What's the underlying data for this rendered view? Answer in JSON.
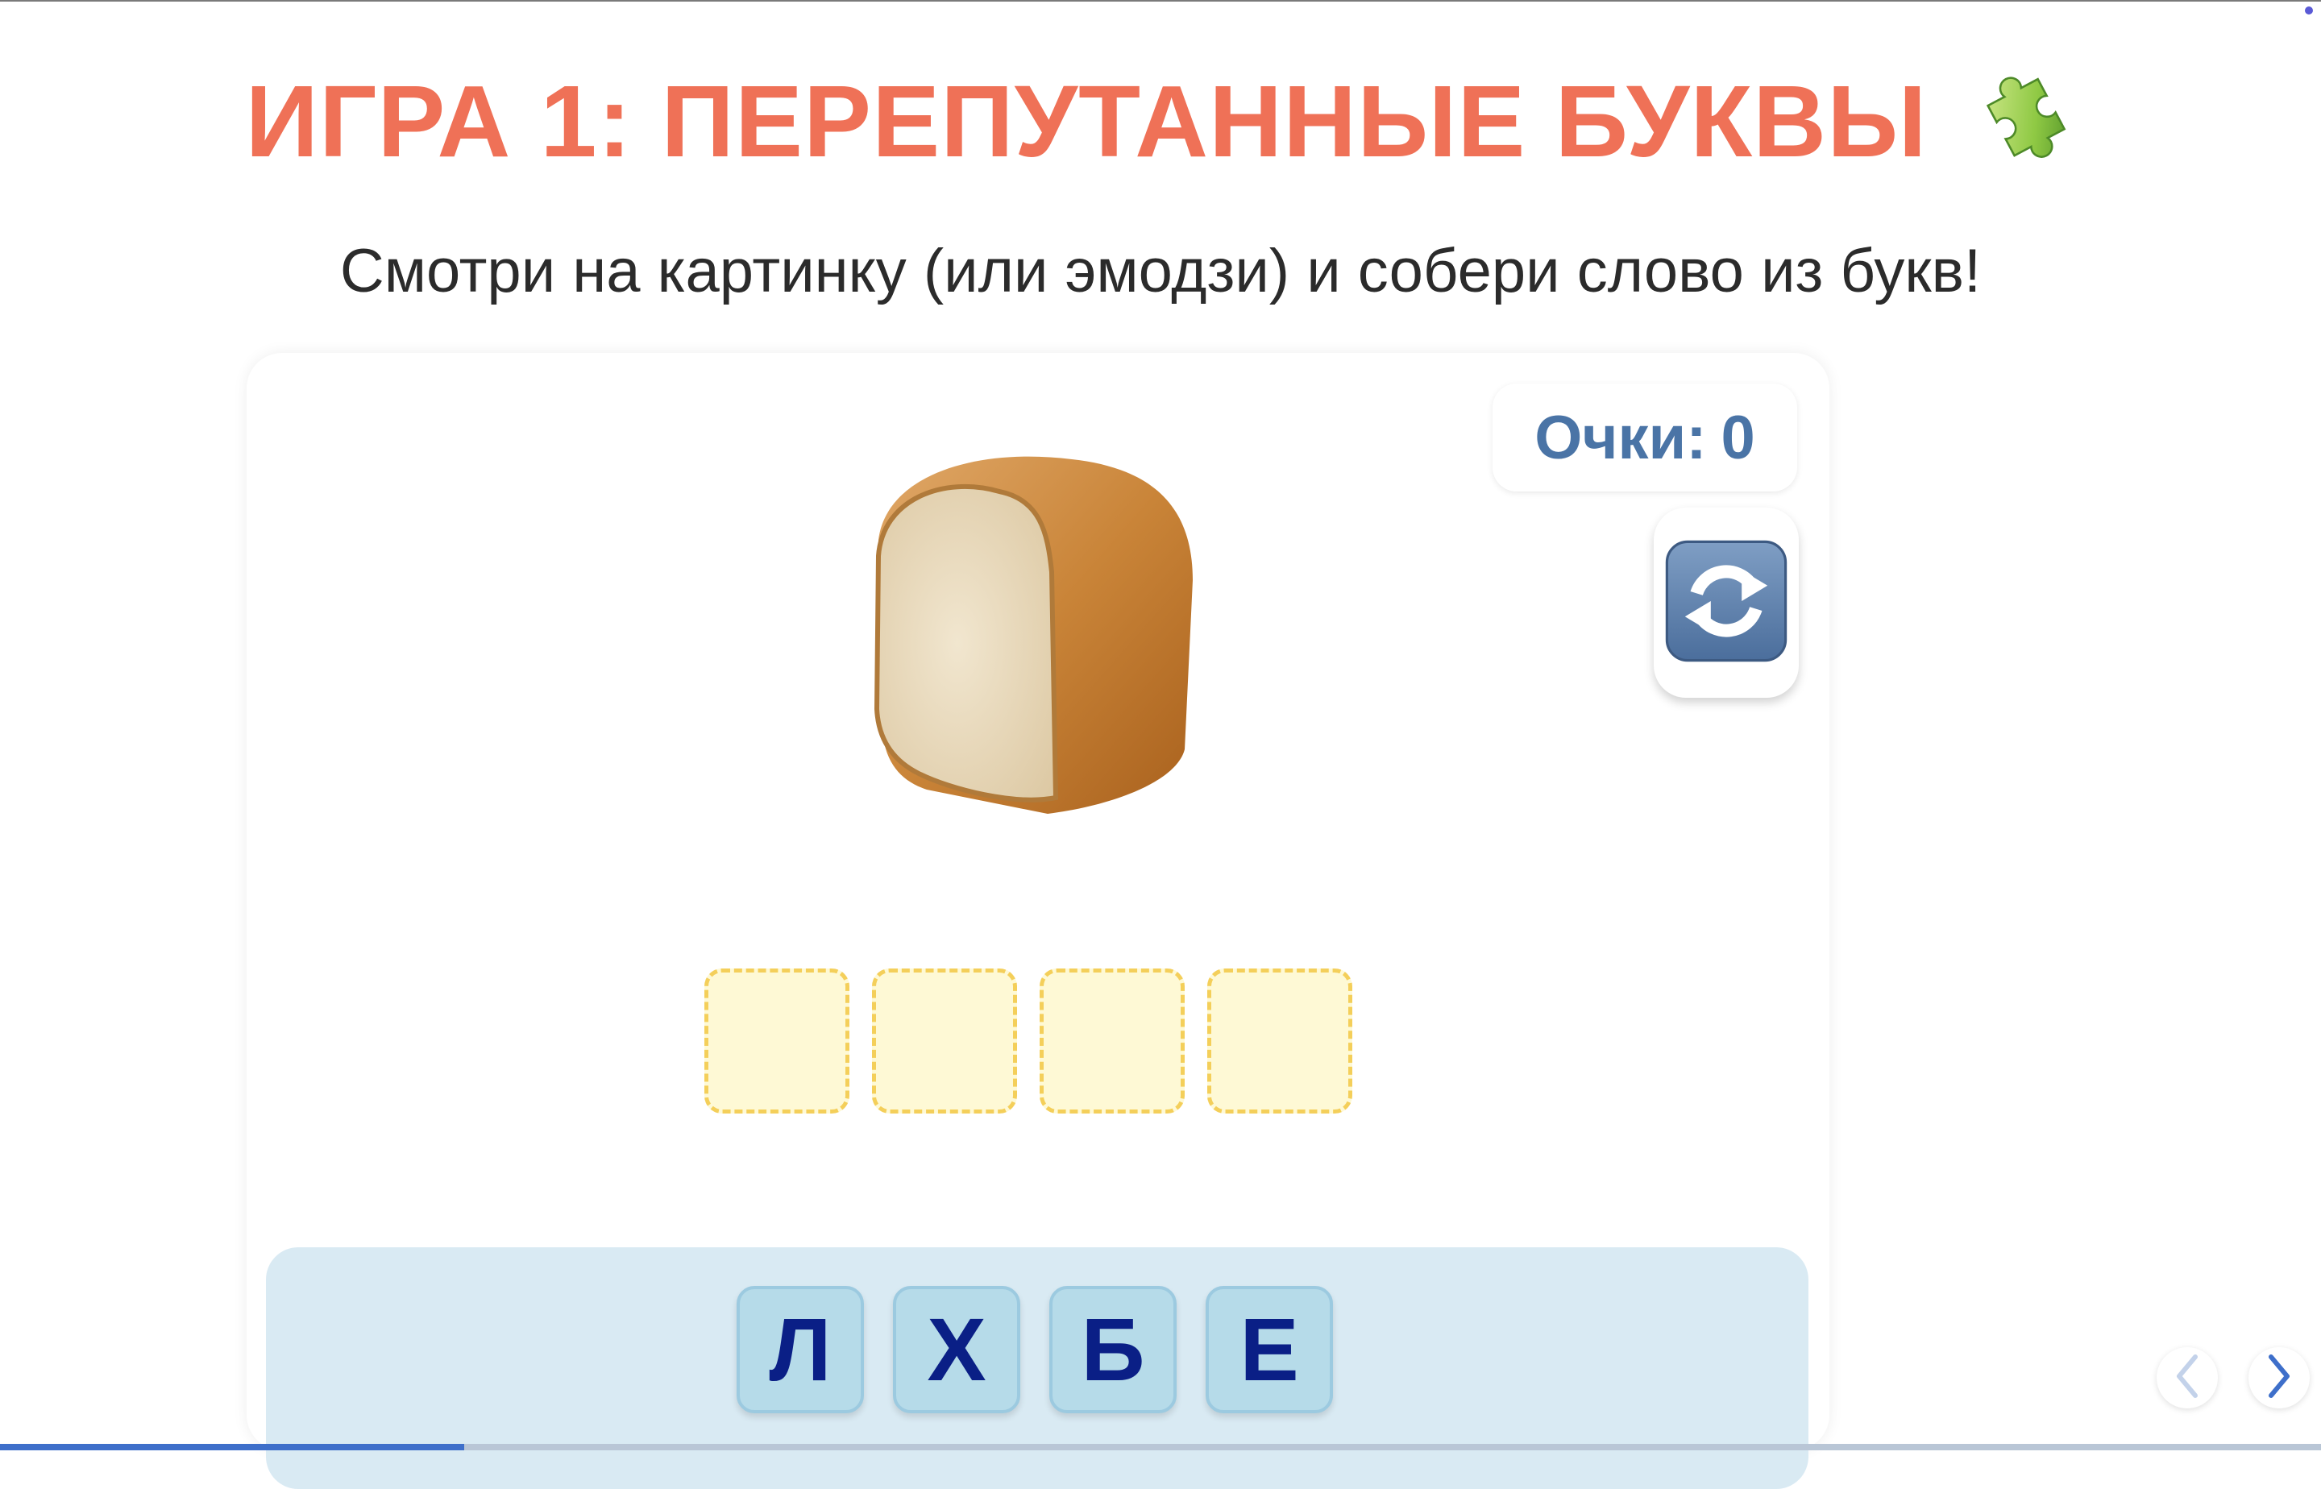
{
  "header": {
    "title": "ИГРА 1: ПЕРЕПУТАННЫЕ БУКВЫ",
    "title_icon": "puzzle-piece-icon",
    "subtitle": "Смотри на картинку (или эмодзи) и собери слово из букв!"
  },
  "game": {
    "score_label": "Очки:",
    "score_value": "0",
    "reload_icon": "reload-arrows-icon",
    "picture_icon": "bread-icon",
    "answer_slots": [
      "",
      "",
      "",
      ""
    ],
    "letters": [
      "Л",
      "Х",
      "Б",
      "Е"
    ]
  },
  "navigation": {
    "prev_icon": "chevron-left-icon",
    "next_icon": "chevron-right-icon",
    "progress_fraction": 0.2
  },
  "colors": {
    "title": "#ef7157",
    "score": "#4a74a6",
    "letter": "#0a1f86",
    "tile": "#b6dbe9",
    "slot_fill": "#fef9d5",
    "slot_border": "#f4cf5a",
    "tray": "#d9eaf3",
    "progress": "#3e6fca"
  }
}
